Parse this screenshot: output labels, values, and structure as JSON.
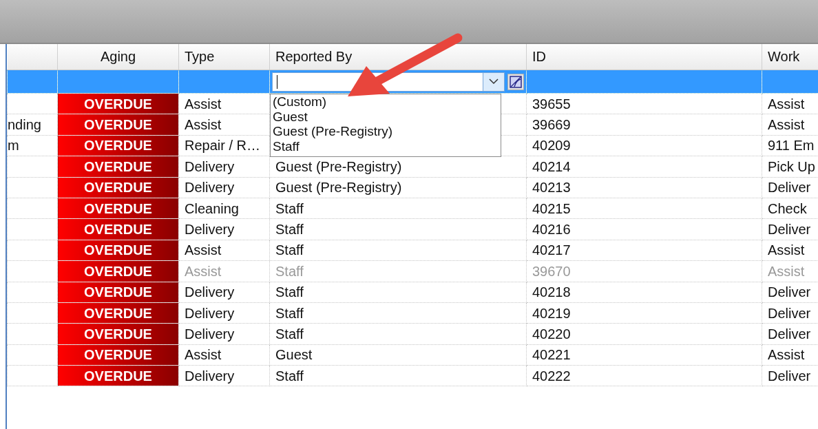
{
  "columns": [
    "Aging",
    "Type",
    "Reported By",
    "ID",
    "Work"
  ],
  "filter_row": {
    "selected": true,
    "options": [
      "(Custom)",
      "Guest",
      "Guest (Pre-Registry)",
      "Staff"
    ]
  },
  "rows": [
    {
      "aging": "OVERDUE",
      "type": "Assist",
      "id": "39655",
      "work": "Assist",
      "disabled": false
    },
    {
      "column_1": "nding",
      "aging": "OVERDUE",
      "type": "Assist",
      "id": "39669",
      "work": "Assist",
      "disabled": false
    },
    {
      "column_1": "m",
      "aging": "OVERDUE",
      "type": "Repair / R…",
      "id": "40209",
      "work": "911 Em",
      "disabled": false
    },
    {
      "aging": "OVERDUE",
      "type": "Delivery",
      "reported_by": "Guest (Pre-Registry)",
      "id": "40214",
      "work": "Pick Up",
      "disabled": false
    },
    {
      "aging": "OVERDUE",
      "type": "Delivery",
      "reported_by": "Guest (Pre-Registry)",
      "id": "40213",
      "work": "Deliver",
      "disabled": false
    },
    {
      "aging": "OVERDUE",
      "type": "Cleaning",
      "reported_by": "Staff",
      "id": "40215",
      "work": "Check",
      "disabled": false
    },
    {
      "aging": "OVERDUE",
      "type": "Delivery",
      "reported_by": "Staff",
      "id": "40216",
      "work": "Deliver",
      "disabled": false
    },
    {
      "aging": "OVERDUE",
      "type": "Assist",
      "reported_by": "Staff",
      "id": "40217",
      "work": "Assist",
      "disabled": false
    },
    {
      "aging": "OVERDUE",
      "type": "Assist",
      "reported_by": "Staff",
      "id": "39670",
      "work": "Assist",
      "disabled": true
    },
    {
      "aging": "OVERDUE",
      "type": "Delivery",
      "reported_by": "Staff",
      "id": "40218",
      "work": "Deliver",
      "disabled": false
    },
    {
      "aging": "OVERDUE",
      "type": "Delivery",
      "reported_by": "Staff",
      "id": "40219",
      "work": "Deliver",
      "disabled": false
    },
    {
      "aging": "OVERDUE",
      "type": "Delivery",
      "reported_by": "Staff",
      "id": "40220",
      "work": "Deliver",
      "disabled": false
    },
    {
      "aging": "OVERDUE",
      "type": "Assist",
      "reported_by": "Guest",
      "id": "40221",
      "work": "Assist",
      "disabled": false
    },
    {
      "aging": "OVERDUE",
      "type": "Delivery",
      "reported_by": "Staff",
      "id": "40222",
      "work": "Deliver",
      "disabled": false
    }
  ]
}
